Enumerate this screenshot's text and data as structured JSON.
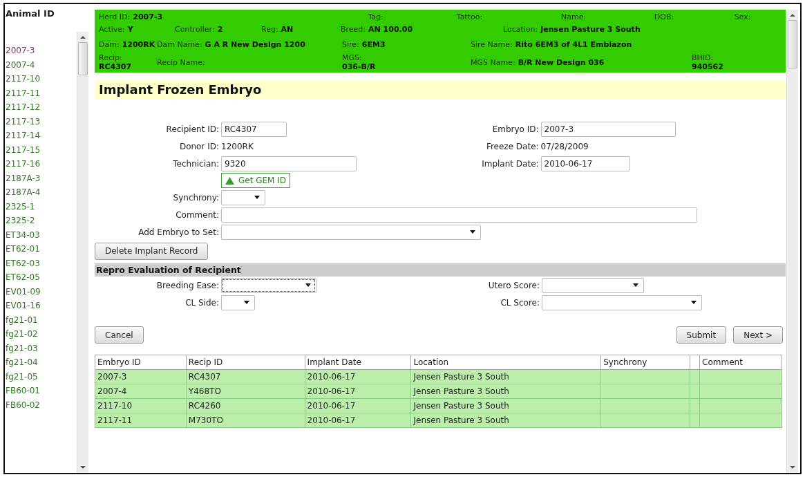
{
  "sidebar": {
    "title": "Animal ID",
    "items": [
      {
        "label": "2007-3",
        "selected": true
      },
      {
        "label": "2007-4",
        "selected": false
      },
      {
        "label": "2117-10",
        "selected": false
      },
      {
        "label": "2117-11",
        "selected": false
      },
      {
        "label": "2117-12",
        "selected": false
      },
      {
        "label": "2117-13",
        "selected": false
      },
      {
        "label": "2117-14",
        "selected": false
      },
      {
        "label": "2117-15",
        "selected": false
      },
      {
        "label": "2117-16",
        "selected": false
      },
      {
        "label": "2187A-3",
        "selected": false
      },
      {
        "label": "2187A-4",
        "selected": false
      },
      {
        "label": "2325-1",
        "selected": false
      },
      {
        "label": "2325-2",
        "selected": false
      },
      {
        "label": "ET34-03",
        "selected": false
      },
      {
        "label": "ET62-01",
        "selected": false
      },
      {
        "label": "ET62-03",
        "selected": false
      },
      {
        "label": "ET62-05",
        "selected": false
      },
      {
        "label": "EV01-09",
        "selected": false
      },
      {
        "label": "EV01-16",
        "selected": false
      },
      {
        "label": "fg21-01",
        "selected": false
      },
      {
        "label": "fg21-02",
        "selected": false
      },
      {
        "label": "fg21-03",
        "selected": false
      },
      {
        "label": "fg21-04",
        "selected": false
      },
      {
        "label": "fg21-05",
        "selected": false
      },
      {
        "label": "FB60-01",
        "selected": false
      },
      {
        "label": "FB60-02",
        "selected": false
      }
    ]
  },
  "header": {
    "rows": [
      {
        "fields": [
          {
            "label": "Herd ID:",
            "value": "2007-3",
            "stacked": false
          },
          {
            "label": "Tag:",
            "stacked": false
          },
          {
            "label": "Tattoo:",
            "stacked": false
          },
          {
            "label": "Name:",
            "stacked": false
          },
          {
            "label": "DOB:",
            "stacked": false
          },
          {
            "label": "Sex:",
            "stacked": false
          }
        ]
      },
      {
        "fields": [
          {
            "label": "Active:",
            "value": "Y",
            "stacked": false
          },
          {
            "label": "Controller:",
            "value": "2",
            "stacked": false
          },
          {
            "label": "Reg:",
            "value": "AN",
            "stacked": false
          },
          {
            "label": "Breed:",
            "value": "AN 100.00",
            "stacked": false
          },
          {
            "label": "Location:",
            "value": "Jensen Pasture 3 South",
            "stacked": false
          }
        ]
      },
      {
        "fields": [
          {
            "label": "Dam:",
            "value": "1200RK",
            "stacked": false
          },
          {
            "label": "Dam Name:",
            "value": "G A R New Design 1200",
            "stacked": false
          },
          {
            "label": "Sire:",
            "value": "6EM3",
            "stacked": false
          },
          {
            "label": "Sire Name:",
            "value": "Rito 6EM3 of 4L1 Emblazon",
            "stacked": false
          }
        ]
      },
      {
        "fields": [
          {
            "label": "Recip:",
            "value": "RC4307",
            "stacked": true
          },
          {
            "label": "Recip Name:",
            "stacked": false
          },
          {
            "label": "MGS:",
            "value": "036-B/R",
            "stacked": true
          },
          {
            "label": "MGS Name:",
            "value": "B/R New Design 036",
            "stacked": false
          },
          {
            "label": "BHID:",
            "value": "940562",
            "stacked": true
          }
        ]
      }
    ]
  },
  "title": "Implant Frozen Embryo",
  "form": {
    "left": [
      {
        "kind": "input",
        "label": "Recipient ID:",
        "value": "RC4307"
      },
      {
        "kind": "text",
        "label": "Donor ID:",
        "value": "1200RK"
      },
      {
        "kind": "input",
        "label": "Technician:",
        "value": "9320"
      },
      {
        "kind": "button",
        "label": "Get GEM ID"
      },
      {
        "kind": "select",
        "label": "Synchrony:",
        "focused": false
      }
    ],
    "right": [
      {
        "kind": "input",
        "label": "Embryo ID:",
        "value": "2007-3"
      },
      {
        "kind": "text",
        "label": "Freeze Date:",
        "value": "07/28/2009"
      },
      {
        "kind": "input",
        "label": "Implant Date:",
        "value": "2010-06-17"
      }
    ],
    "wide": [
      {
        "kind": "input",
        "label": "Comment:"
      },
      {
        "kind": "select",
        "label": "Add Embryo to Set:",
        "focused": false
      }
    ],
    "delete_button": "Delete Implant Record"
  },
  "evaluation": {
    "title": "Repro Evaluation of Recipient",
    "fields": [
      {
        "kind": "select",
        "label": "Breeding Ease:",
        "focused": true
      },
      {
        "kind": "select",
        "label": "Utero Score:",
        "focused": false
      },
      {
        "kind": "select",
        "label": "CL Side:",
        "focused": false
      },
      {
        "kind": "select",
        "label": "CL Score:",
        "focused": false
      }
    ]
  },
  "buttons": {
    "cancel": "Cancel",
    "submit": "Submit",
    "next": "Next >"
  },
  "table": {
    "columns": [
      {
        "kind": "text",
        "label": "Embryo ID"
      },
      {
        "kind": "text",
        "label": "Recip ID"
      },
      {
        "kind": "text",
        "label": "Implant Date"
      },
      {
        "kind": "text",
        "label": "Location"
      },
      {
        "kind": "text",
        "label": "Synchrony"
      },
      {
        "kind": "spacer"
      },
      {
        "kind": "text",
        "label": "Comment"
      }
    ],
    "rows": [
      [
        "2007-3",
        "RC4307",
        "2010-06-17",
        "Jensen Pasture 3 South"
      ],
      [
        "2007-4",
        "Y468TO",
        "2010-06-17",
        "Jensen Pasture 3 South"
      ],
      [
        "2117-10",
        "RC4260",
        "2010-06-17",
        "Jensen Pasture 3 South"
      ],
      [
        "2117-11",
        "M730TO",
        "2010-06-17",
        "Jensen Pasture 3 South"
      ]
    ]
  }
}
